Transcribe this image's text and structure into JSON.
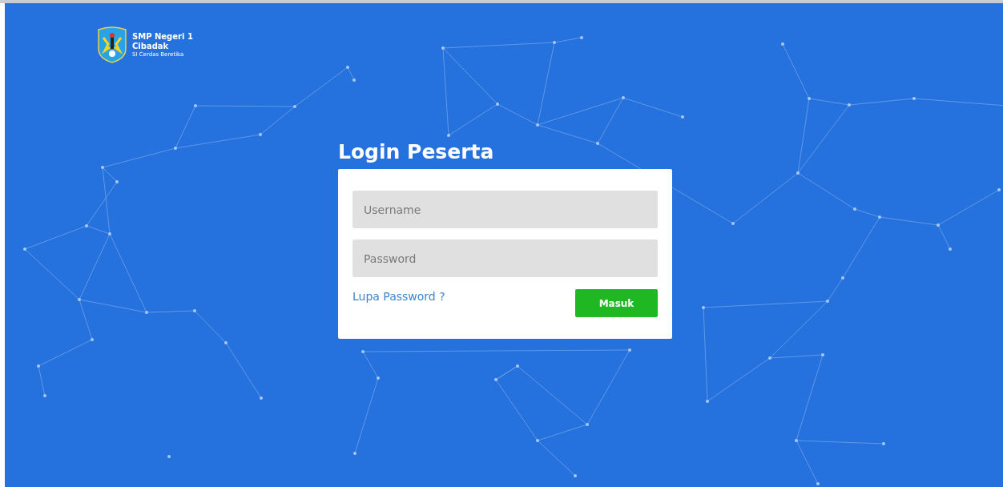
{
  "school": {
    "name_line_1": "SMP Negeri 1",
    "name_line_2": "Cibadak",
    "motto": "SI Cerdas Beretika"
  },
  "login": {
    "title": "Login Peserta",
    "username": {
      "placeholder": "Username"
    },
    "password": {
      "placeholder": "Password"
    },
    "forgot_link": "Lupa Password ?",
    "submit_button": "Masuk"
  }
}
